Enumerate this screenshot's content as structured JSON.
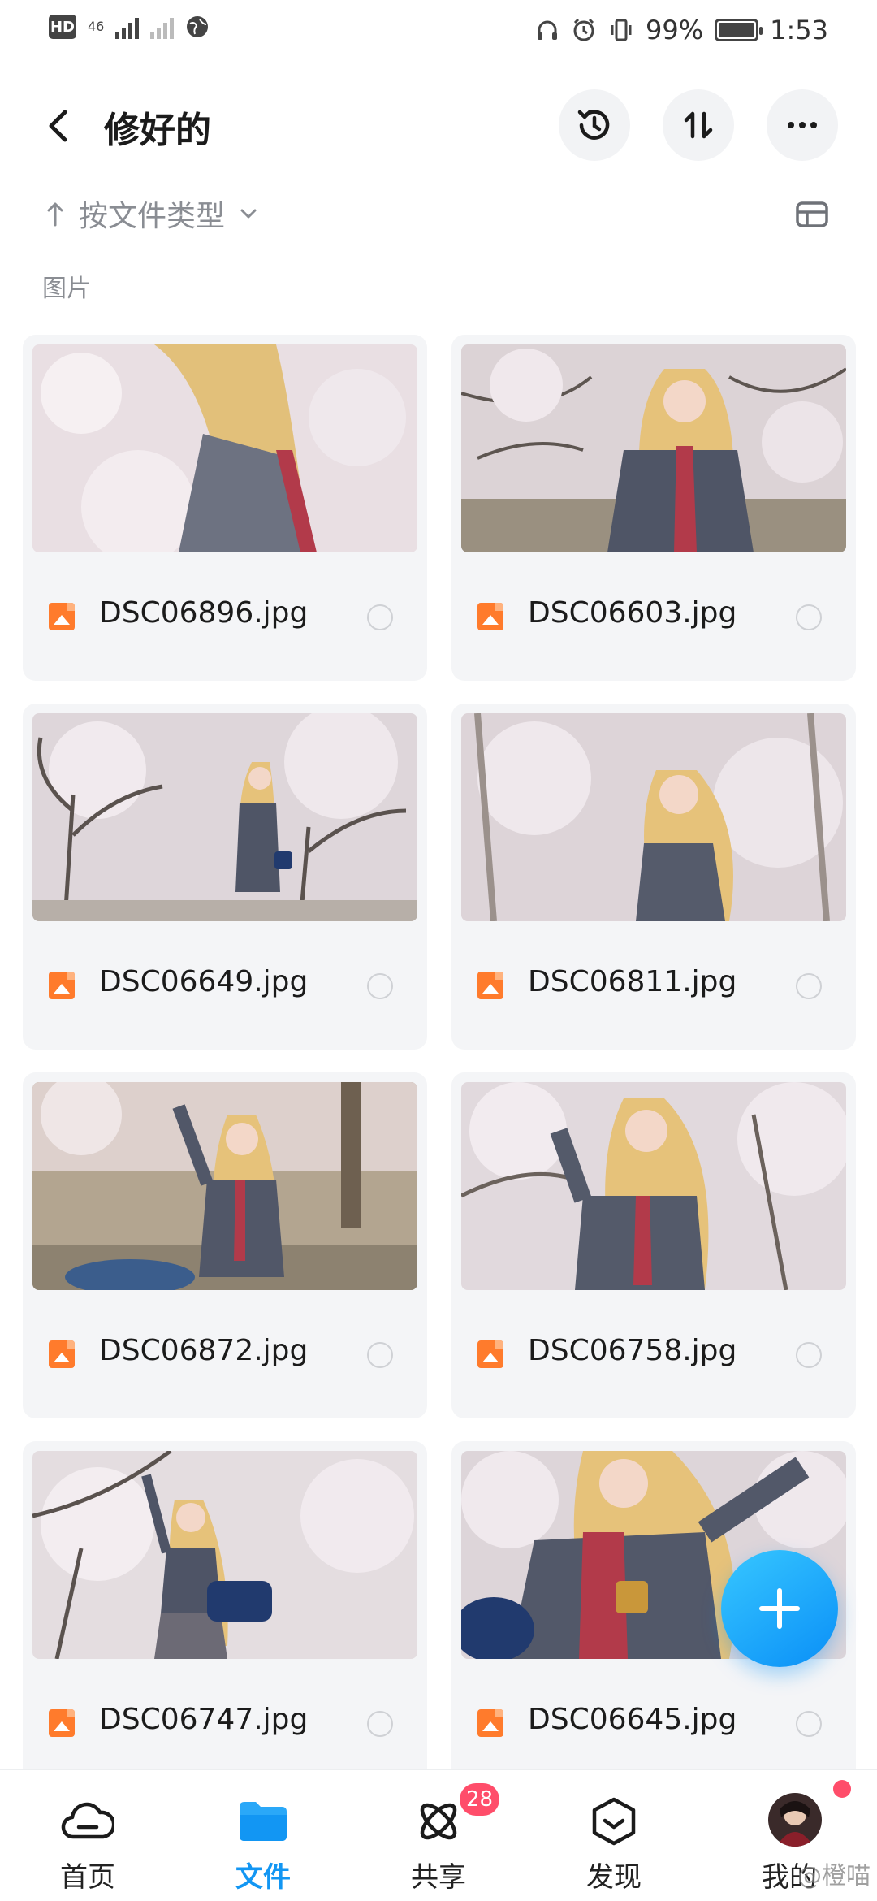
{
  "status_bar": {
    "hd": "HD",
    "net_label": "46",
    "battery": "99%",
    "battery_level": 0.99,
    "time": "1:53"
  },
  "header": {
    "title": "修好的",
    "icons": [
      "back-arrow-icon",
      "history-icon",
      "sort-icon",
      "more-icon"
    ]
  },
  "sort": {
    "label": "按文件类型"
  },
  "section": {
    "label": "图片"
  },
  "files": [
    {
      "name": "DSC06896.jpg"
    },
    {
      "name": "DSC06603.jpg"
    },
    {
      "name": "DSC06649.jpg"
    },
    {
      "name": "DSC06811.jpg"
    },
    {
      "name": "DSC06872.jpg"
    },
    {
      "name": "DSC06758.jpg"
    },
    {
      "name": "DSC06747.jpg"
    },
    {
      "name": "DSC06645.jpg"
    }
  ],
  "nav": [
    {
      "label": "首页",
      "icon": "cloud-icon"
    },
    {
      "label": "文件",
      "icon": "folder-icon"
    },
    {
      "label": "共享",
      "icon": "share-orbit-icon",
      "badge": "28"
    },
    {
      "label": "发现",
      "icon": "discover-icon"
    },
    {
      "label": "我的",
      "icon": "avatar"
    }
  ],
  "watermark": "@橙喵",
  "colors": {
    "accent": "#1296f3",
    "badge": "#ff4d6a",
    "file_icon": "#ff7b2c"
  }
}
